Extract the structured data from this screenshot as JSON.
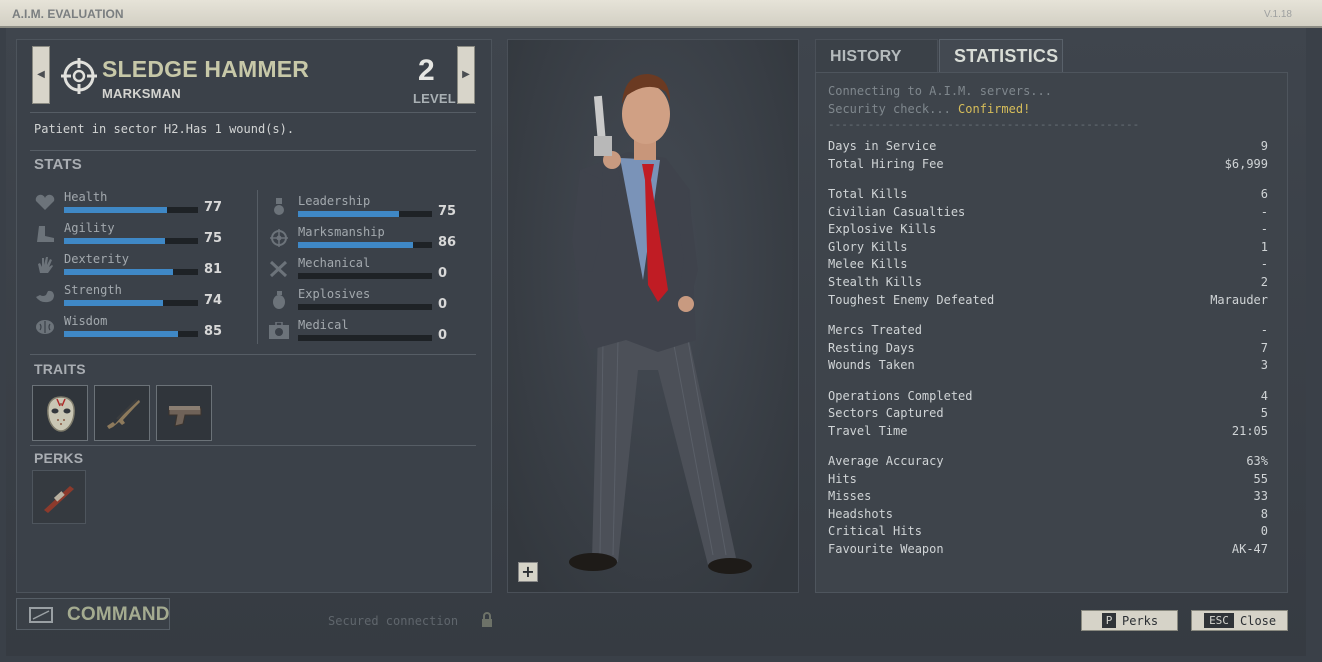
{
  "window": {
    "title": "A.I.M. EVALUATION",
    "version": "V.1.18"
  },
  "merc": {
    "name": "SLEDGE HAMMER",
    "role": "MARKSMAN",
    "level": "2",
    "level_label": "LEVEL",
    "status": "Patient in sector H2.Has 1 wound(s)."
  },
  "sections": {
    "stats": "STATS",
    "traits": "TRAITS",
    "perks": "PERKS"
  },
  "stats_left": [
    {
      "name": "Health",
      "value": "77",
      "icon": "heart-icon"
    },
    {
      "name": "Agility",
      "value": "75",
      "icon": "boot-icon"
    },
    {
      "name": "Dexterity",
      "value": "81",
      "icon": "hand-icon"
    },
    {
      "name": "Strength",
      "value": "74",
      "icon": "arm-icon"
    },
    {
      "name": "Wisdom",
      "value": "85",
      "icon": "brain-icon"
    }
  ],
  "stats_right": [
    {
      "name": "Leadership",
      "value": "75",
      "icon": "medal-icon"
    },
    {
      "name": "Marksmanship",
      "value": "86",
      "icon": "crosshair-icon"
    },
    {
      "name": "Mechanical",
      "value": "0",
      "icon": "tools-icon"
    },
    {
      "name": "Explosives",
      "value": "0",
      "icon": "grenade-icon"
    },
    {
      "name": "Medical",
      "value": "0",
      "icon": "medkit-icon"
    }
  ],
  "traits": [
    "hockey-mask-icon",
    "rifle-icon",
    "pistol-icon"
  ],
  "perks": [
    "scope-icon"
  ],
  "footer": {
    "command": "COMMAND",
    "secured": "Secured connection"
  },
  "tabs": {
    "history": "HISTORY",
    "statistics": "STATISTICS"
  },
  "console": {
    "line1": "Connecting to A.I.M. servers...",
    "line2_prefix": "Security check... ",
    "line2_status": "Confirmed!",
    "separator": "-----------------------------------------------"
  },
  "statistics": [
    {
      "label": "Days in Service",
      "value": "9"
    },
    {
      "label": "Total Hiring Fee",
      "value": "$6,999"
    },
    {
      "label": "Total Kills",
      "value": "6"
    },
    {
      "label": "Civilian Casualties",
      "value": "-"
    },
    {
      "label": "Explosive Kills",
      "value": "-"
    },
    {
      "label": "Glory Kills",
      "value": "1"
    },
    {
      "label": "Melee Kills",
      "value": "-"
    },
    {
      "label": "Stealth Kills",
      "value": "2"
    },
    {
      "label": "Toughest Enemy Defeated",
      "value": "Marauder"
    },
    {
      "label": "Mercs Treated",
      "value": "-"
    },
    {
      "label": "Resting Days",
      "value": "7"
    },
    {
      "label": "Wounds Taken",
      "value": "3"
    },
    {
      "label": "Operations Completed",
      "value": "4"
    },
    {
      "label": "Sectors Captured",
      "value": "5"
    },
    {
      "label": "Travel Time",
      "value": "21:05"
    },
    {
      "label": "Average Accuracy",
      "value": "63%"
    },
    {
      "label": "Hits",
      "value": "55"
    },
    {
      "label": "Misses",
      "value": "33"
    },
    {
      "label": "Headshots",
      "value": "8"
    },
    {
      "label": "Critical Hits",
      "value": "0"
    },
    {
      "label": "Favourite Weapon",
      "value": "AK-47"
    }
  ],
  "buttons": {
    "perks_key": "P",
    "perks_label": "Perks",
    "close_key": "ESC",
    "close_label": "Close"
  },
  "colors": {
    "accent_bar": "#3f88c6",
    "confirmed": "#d6bd5a",
    "name": "#c7c8a8"
  }
}
